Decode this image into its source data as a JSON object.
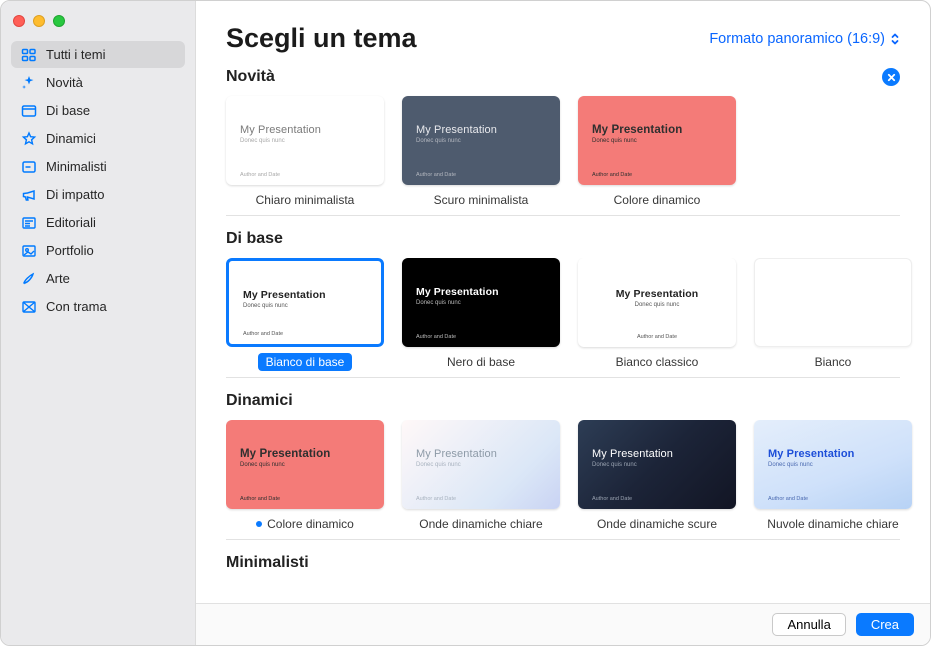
{
  "header": {
    "title": "Scegli un tema",
    "format_label": "Formato panoramico (16:9)"
  },
  "sidebar": {
    "items": [
      {
        "label": "Tutti i temi",
        "icon": "grid-icon"
      },
      {
        "label": "Novità",
        "icon": "sparkle-icon"
      },
      {
        "label": "Di base",
        "icon": "folder-icon"
      },
      {
        "label": "Dinamici",
        "icon": "star-icon"
      },
      {
        "label": "Minimalisti",
        "icon": "doc-icon"
      },
      {
        "label": "Di impatto",
        "icon": "megaphone-icon"
      },
      {
        "label": "Editoriali",
        "icon": "newspaper-icon"
      },
      {
        "label": "Portfolio",
        "icon": "image-icon"
      },
      {
        "label": "Arte",
        "icon": "brush-icon"
      },
      {
        "label": "Con trama",
        "icon": "texture-icon"
      }
    ]
  },
  "placeholder": {
    "title": "My Presentation",
    "subtitle": "Donec quis nunc",
    "footer": "Author and Date"
  },
  "sections": {
    "novita": {
      "title": "Novità",
      "themes": [
        {
          "label": "Chiaro minimalista"
        },
        {
          "label": "Scuro minimalista"
        },
        {
          "label": "Colore dinamico"
        }
      ]
    },
    "dibase": {
      "title": "Di base",
      "themes": [
        {
          "label": "Bianco di base"
        },
        {
          "label": "Nero di base"
        },
        {
          "label": "Bianco classico"
        },
        {
          "label": "Bianco"
        }
      ]
    },
    "dinamici": {
      "title": "Dinamici",
      "themes": [
        {
          "label": "Colore dinamico"
        },
        {
          "label": "Onde dinamiche chiare"
        },
        {
          "label": "Onde dinamiche scure"
        },
        {
          "label": "Nuvole dinamiche chiare"
        }
      ]
    },
    "minimalisti": {
      "title": "Minimalisti"
    }
  },
  "footer": {
    "cancel": "Annulla",
    "create": "Crea"
  }
}
